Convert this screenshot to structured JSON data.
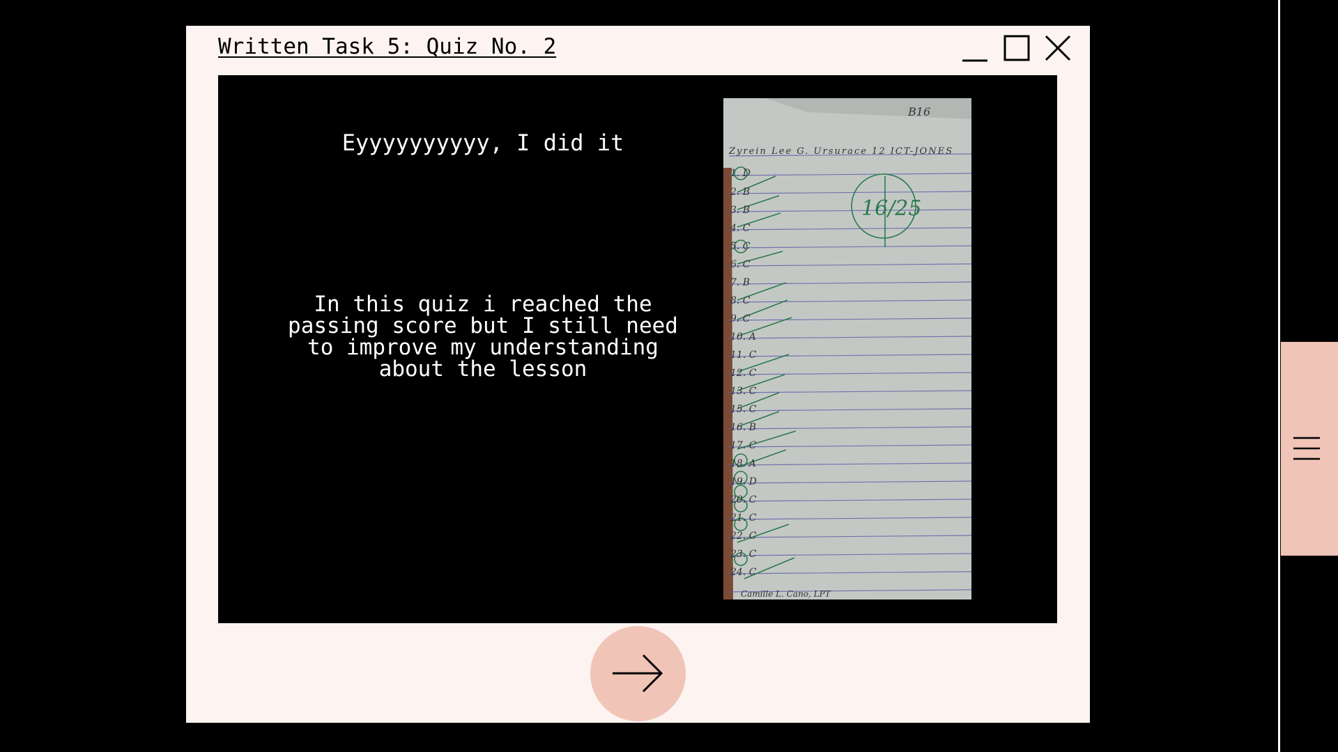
{
  "window": {
    "title": "Written Task 5: Quiz No. 2",
    "controls": [
      "minimize-icon",
      "maximize-icon",
      "close-icon"
    ]
  },
  "slide": {
    "headline": "Eyyyyyyyyyy, I did it",
    "reflection": "In this quiz i reached the passing score but I still need to improve my understanding about the lesson",
    "photo": {
      "description_icon": "graded-quiz-paper",
      "header_note": "B16",
      "name_line": "Zyrein Lee G. Ursurace 12 ICT-JONES",
      "score": "16/25",
      "signature": "Camille L. Cano, LPT"
    }
  },
  "navigation": {
    "next_icon": "arrow-right-icon",
    "menu_icon": "hamburger-menu-icon"
  },
  "colors": {
    "window_bg": "#fdf4f1",
    "content_bg": "#000000",
    "accent": "#f0c4b6",
    "text_light": "#ffffff",
    "text_dark": "#000000"
  }
}
